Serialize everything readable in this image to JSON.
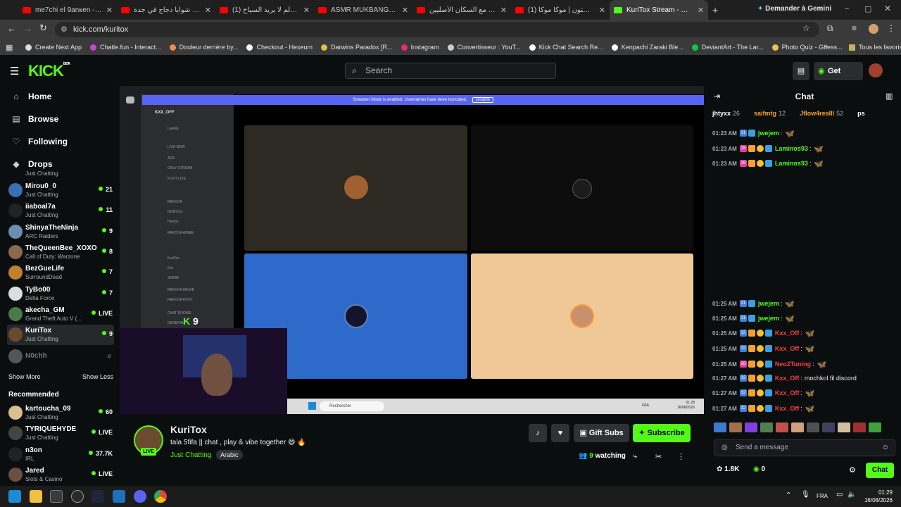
{
  "browser": {
    "tabs": [
      {
        "title": "me7chi el 9arwen - YouTube",
        "active": false
      },
      {
        "title": "افضل شوايا دجاج في جدة 🍗 - YouTube",
        "active": false
      },
      {
        "title": "(1) أجمل بلد في العالم لا يريد السياح",
        "active": false
      },
      {
        "title": "ASMR MUKBANG | GRILLED",
        "active": false
      },
      {
        "title": "دخلت البحر مع السكان الأصليين",
        "active": false
      },
      {
        "title": "(1) سبيستون | موكا موكا",
        "active": false
      },
      {
        "title": "KuriTox Stream - Watch Live",
        "active": true
      }
    ],
    "gemini": "Demander à Gemini",
    "url": "kick.com/kuritox",
    "bookmarks": [
      "Create Next App",
      "Chatle.fun - Interact...",
      "Douleur derrière by...",
      "Checkout - Hexeum",
      "Darwins Paradox [R...",
      "Instagram",
      "Convertisseur : YouT...",
      "Kick Chat Search Re...",
      "Kenpachi Zaraki Ble...",
      "DeviantArt - The Lar...",
      "Photo Quiz - Guess..."
    ],
    "all_bookmarks": "Tous les favoris"
  },
  "header": {
    "logo": "KICK",
    "beta": "BETA",
    "search_placeholder": "Search",
    "get_kicks": "Get KICKs"
  },
  "sidebar": {
    "nav": [
      {
        "label": "Home",
        "icon": "home-icon"
      },
      {
        "label": "Browse",
        "icon": "browse-icon"
      },
      {
        "label": "Following",
        "icon": "heart-icon"
      },
      {
        "label": "Drops",
        "icon": "drops-icon"
      }
    ],
    "partial_category": "Just Chatting",
    "following": [
      {
        "name": "Mirou0_0",
        "category": "Just Chatting",
        "viewers": "21",
        "color": "#3b6fb5"
      },
      {
        "name": "iiaboal7a",
        "category": "Just Chatting",
        "viewers": "11",
        "color": "#222222"
      },
      {
        "name": "ShinyaTheNinja",
        "category": "ARC Raiders",
        "viewers": "9",
        "color": "#6a8fb0"
      },
      {
        "name": "TheQueenBee_XOXO",
        "category": "Call of Duty: Warzone",
        "viewers": "8",
        "color": "#8a6a4a"
      },
      {
        "name": "BezGueLife",
        "category": "SurroundDead",
        "viewers": "7",
        "color": "#c08030"
      },
      {
        "name": "TyBo00",
        "category": "Delta Force",
        "viewers": "7",
        "color": "#dddddd"
      },
      {
        "name": "akecha_GM",
        "category": "Grand Theft Auto V (...",
        "viewers": "LIVE",
        "color": "#4a7a4a"
      },
      {
        "name": "KuriTox",
        "category": "Just Chatting",
        "viewers": "9",
        "color": "#6b4a2e"
      }
    ],
    "offline": {
      "name": "N0chh"
    },
    "show_more": "Show More",
    "show_less": "Show Less",
    "recommended_title": "Recommended",
    "recommended": [
      {
        "name": "kartoucha_09",
        "category": "Just Chatting",
        "viewers": "60",
        "color": "#d8c090"
      },
      {
        "name": "TYRIQUEHYDE",
        "category": "Just Chatting",
        "viewers": "LIVE",
        "color": "#444444"
      },
      {
        "name": "n3on",
        "category": "IRL",
        "viewers": "37.7K",
        "color": "#222222"
      },
      {
        "name": "Jared",
        "category": "Slots & Casino",
        "viewers": "LIVE",
        "color": "#6a5040"
      }
    ]
  },
  "stream": {
    "streamer_mode_msg": "Streamer Mode is enabled. Usernames have been truncated.",
    "disable": "Disable",
    "server_name": "KXX_OFF",
    "channels": [
      "LEAVE",
      "LIVE-NOW",
      "ADS",
      "ONLY STREAM",
      "FOOT LIVE",
      "RAKCHA",
      "Ghi6Tcha",
      "Hexibo",
      "RAKCHA ANIME",
      "KuriTox",
      "Kxx",
      "SMF86",
      "RAKCHA MOVIE",
      "RAKCHA FOOT",
      "CHAT ROOMS",
      "GENERAL"
    ],
    "overlay_count": "9",
    "taskbar_search": "Rechercher",
    "taskbar_lang": "FRA",
    "taskbar_time": "01:28",
    "taskbar_date": "16/08/2026"
  },
  "channel": {
    "name": "KuriTox",
    "live": "LIVE",
    "title": "tala 5fifa || chat , play & vibe together 😄 🔥",
    "category": "Just Chatting",
    "tag": "Arabic",
    "gift_subs": "Gift Subs",
    "subscribe": "Subscribe",
    "watching_count": "9",
    "watching_label": "watching"
  },
  "chat": {
    "title": "Chat",
    "leaders": [
      {
        "name": "jhtyxx",
        "count": "26"
      },
      {
        "name": "saifmtg",
        "count": "12"
      },
      {
        "name": "Jflow4realll",
        "count": "52"
      },
      {
        "name": "ps",
        "count": ""
      }
    ],
    "messages": [
      {
        "time": "01:23 AM",
        "badge": "31",
        "user": "jwejem",
        "text": "",
        "color": "#53fc18",
        "emote": true
      },
      {
        "time": "01:23 AM",
        "badge": "28",
        "user": "Laminos93",
        "text": "",
        "color": "#53fc18",
        "emote": true
      },
      {
        "time": "01:23 AM",
        "badge": "28",
        "user": "Laminos93",
        "text": "",
        "color": "#53fc18",
        "emote": true
      },
      {
        "time": "01:25 AM",
        "badge": "31",
        "user": "jwejem",
        "text": "",
        "color": "#53fc18",
        "emote": true
      },
      {
        "time": "01:25 AM",
        "badge": "31",
        "user": "jwejem",
        "text": "",
        "color": "#53fc18",
        "emote": true
      },
      {
        "time": "01:25 AM",
        "badge": "32",
        "user": "Kxx_Off",
        "text": "",
        "color": "#ff3c3c",
        "emote": true
      },
      {
        "time": "01:25 AM",
        "badge": "32",
        "user": "Kxx_Off",
        "text": "",
        "color": "#ff3c3c",
        "emote": true
      },
      {
        "time": "01:25 AM",
        "badge": "28",
        "user": "Neo2Tuning",
        "text": "",
        "color": "#ff3c3c",
        "emote": true
      },
      {
        "time": "01:27 AM",
        "badge": "32",
        "user": "Kxx_Off",
        "text": "mochkol fil discord",
        "color": "#ff3c3c",
        "emote": false
      },
      {
        "time": "01:27 AM",
        "badge": "32",
        "user": "Kxx_Off",
        "text": "",
        "color": "#ff3c3c",
        "emote": true
      },
      {
        "time": "01:27 AM",
        "badge": "32",
        "user": "Kxx_Off",
        "text": "",
        "color": "#ff3c3c",
        "emote": true
      }
    ],
    "placeholder": "Send a message",
    "points": "1.8K",
    "kicks": "0",
    "chat_button": "Chat"
  },
  "taskbar": {
    "lang": "FRA",
    "time": "01:29",
    "date": "16/08/2026"
  },
  "colors": {
    "kick_green": "#53fc18",
    "discord_blurple": "#5865f2",
    "bg": "#0b0e0f"
  }
}
